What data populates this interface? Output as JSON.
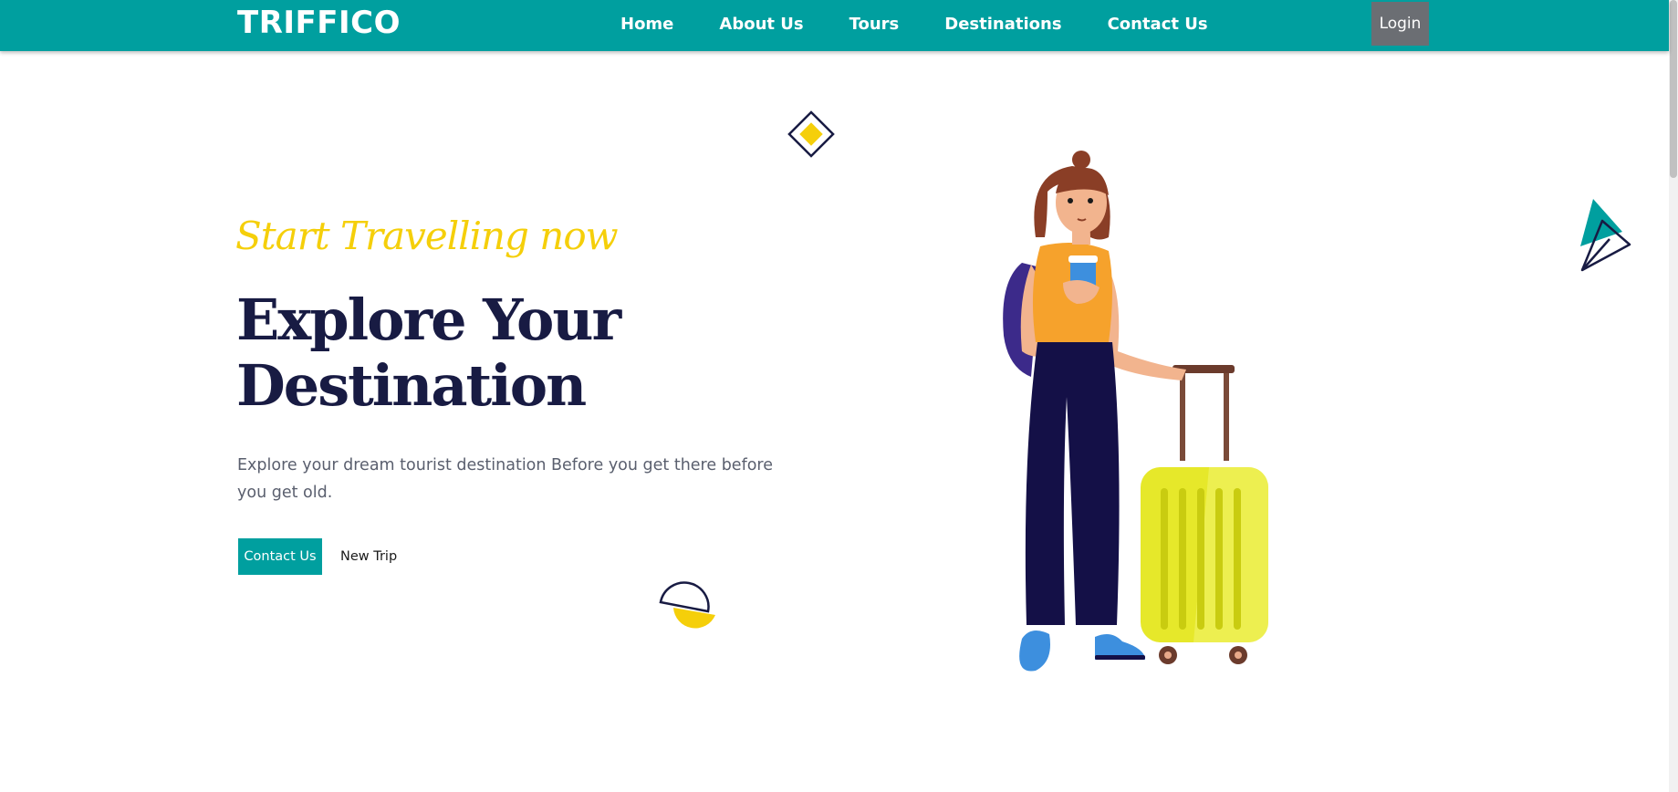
{
  "brand": "TRIFFICO",
  "nav": {
    "items": [
      "Home",
      "About Us",
      "Tours",
      "Destinations",
      "Contact Us"
    ],
    "login_label": "Login"
  },
  "hero": {
    "tagline": "Start Travelling now",
    "title_line1": "Explore Your",
    "title_line2": "Destination",
    "description": "Explore your dream tourist destination Before you get there before you get old.",
    "primary_button": "Contact Us",
    "secondary_button": "New Trip"
  },
  "colors": {
    "primary": "#009f9f",
    "accent": "#f5cf0a",
    "heading": "#181b43",
    "login_bg": "#6b6e73"
  },
  "icons": [
    "diamond-shape-icon",
    "half-circle-shape-icon",
    "paper-plane-shape-icon"
  ]
}
